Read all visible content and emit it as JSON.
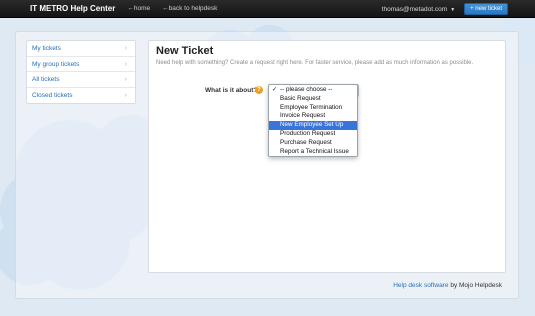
{
  "nav": {
    "brand": "IT METRO Help Center",
    "home_link": "←home",
    "back_link": "←back to helpdesk",
    "user_email": "thomas@metadot.com",
    "new_ticket_label": "+ new ticket"
  },
  "sidebar": {
    "items": [
      {
        "label": "My tickets"
      },
      {
        "label": "My group tickets"
      },
      {
        "label": "All tickets"
      },
      {
        "label": "Closed tickets"
      }
    ]
  },
  "main": {
    "title": "New Ticket",
    "subtitle": "Need help with something? Create a request right here. For faster service, please add as much information as possible.",
    "question_label": "What is it about?",
    "help_icon_glyph": "?",
    "dropdown": {
      "options": [
        {
          "label": "-- please choose --",
          "checked": true
        },
        {
          "label": "Basic Request"
        },
        {
          "label": "Employee Termination"
        },
        {
          "label": "Invoice Request"
        },
        {
          "label": "New Employee Set Up",
          "highlighted": true
        },
        {
          "label": "Production Request"
        },
        {
          "label": "Purchase Request"
        },
        {
          "label": "Report a Technical Issue"
        }
      ]
    }
  },
  "footer": {
    "link_text": "Help desk software",
    "suffix": "by Mojo Helpdesk"
  },
  "colors": {
    "accent": "#2a78c2",
    "highlight": "#3a74d9",
    "topbar": "#1c1c1c",
    "link": "#2a6fb5",
    "help_icon": "#f0a020"
  }
}
